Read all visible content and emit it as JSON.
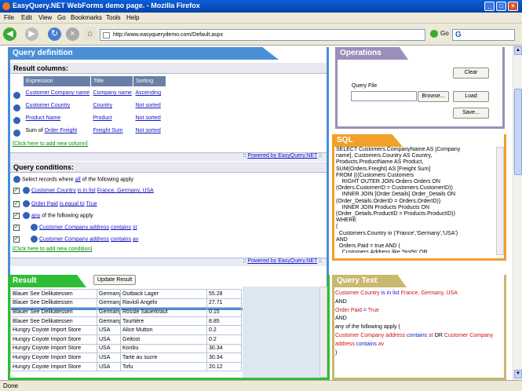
{
  "window": {
    "title": "EasyQuery.NET WebForms demo page. - Mozilla Firefox"
  },
  "menu": [
    "File",
    "Edit",
    "View",
    "Go",
    "Bookmarks",
    "Tools",
    "Help"
  ],
  "nav": {
    "url": "http://www.easyquerydemo.com/Default.aspx",
    "go_label": "Go",
    "search_logo": "G"
  },
  "status": "Done",
  "query_definition": {
    "title": "Query definition",
    "result_columns_label": "Result columns:",
    "headers": [
      "Expression",
      "Title",
      "Sorting"
    ],
    "columns": [
      {
        "pre": "",
        "expr": "Customer Company name",
        "title": "Company name",
        "sort": "Ascending"
      },
      {
        "pre": "",
        "expr": "Customer Country",
        "title": "Country",
        "sort": "Not sorted"
      },
      {
        "pre": "",
        "expr": "Product Name",
        "title": "Product",
        "sort": "Not sorted"
      },
      {
        "pre": "Sum of ",
        "expr": "Order Freight",
        "title": "Freight Sum",
        "sort": "Not sorted"
      }
    ],
    "add_column": "[Click here to add new column]",
    "powered": "Powered by EasyQuery.NET",
    "query_conditions_label": "Query conditions:",
    "cond_root": {
      "pre": "Select records where",
      "mode": "all",
      "post": "of the following apply"
    },
    "conditions": [
      {
        "field": "Customer Country",
        "op": "is in list",
        "value": "France, Germany, USA"
      },
      {
        "field": "Order Paid",
        "op": "is equal to",
        "value": "True"
      },
      {
        "field": "any",
        "op": "",
        "value": "of the following apply"
      },
      {
        "field": "Customer Company address",
        "op": "contains",
        "value": "st"
      },
      {
        "field": "Customer Company address",
        "op": "contains",
        "value": "av"
      }
    ],
    "add_condition": "[Click here to add new condition]"
  },
  "operations": {
    "title": "Operations",
    "clear": "Clear",
    "query_file_label": "Query File",
    "browse": "Browse...",
    "load": "Load",
    "save": "Save..."
  },
  "sql": {
    "title": "SQL",
    "text": "SELECT Customers.CompanyName AS [Company\nname], Customers.Country AS Country,\nProducts.ProductName AS Product,\nSUM(Orders.Freight) AS [Freight Sum]\nFROM (((Customers Customers\n    RIGHT OUTER JOIN Orders Orders ON\n(Orders.CustomerID = Customers.CustomerID))\n    INNER JOIN [Order Details] Order_Details ON\n(Order_Details.OrderID = Orders.OrderID))\n    INNER JOIN Products Products ON\n(Order_Details.ProductID = Products.ProductID))\nWHERE\n(\n  Customers.Country in ('France','Germany','USA')\nAND\n  Orders.Paid = true AND (\n    Customers.Address like '%st%' OR"
  },
  "result": {
    "title": "Result",
    "update": "Update Result",
    "rows": [
      [
        "Blauer See Delikatessen",
        "Germany",
        "Outback Lager",
        "55.28"
      ],
      [
        "Blauer See Delikatessen",
        "Germany",
        "Ravioli Angelo",
        "27.71"
      ],
      [
        "Blauer See Delikatessen",
        "Germany",
        "Rössle Sauerkraut",
        "0.15"
      ],
      [
        "Blauer See Delikatessen",
        "Germany",
        "Tourtière",
        "8.85"
      ],
      [
        "Hungry Coyote Import Store",
        "USA",
        "Alice Mutton",
        "0.2"
      ],
      [
        "Hungry Coyote Import Store",
        "USA",
        "Geitost",
        "0.2"
      ],
      [
        "Hungry Coyote Import Store",
        "USA",
        "Konbu",
        "30.34"
      ],
      [
        "Hungry Coyote Import Store",
        "USA",
        "Tarte au sucre",
        "30.34"
      ],
      [
        "Hungry Coyote Import Store",
        "USA",
        "Tofu",
        "20.12"
      ]
    ]
  },
  "query_text": {
    "title": "Query Text",
    "lines": [
      [
        {
          "t": "Customer Country",
          "c": "red"
        },
        {
          "t": " is in list ",
          "c": "blu"
        },
        {
          "t": "France, Germany, USA",
          "c": "red"
        }
      ],
      [
        {
          "t": "AND",
          "c": ""
        }
      ],
      [
        {
          "t": "Order Paid",
          "c": "red"
        },
        {
          "t": " = ",
          "c": "blu"
        },
        {
          "t": "True",
          "c": "red"
        }
      ],
      [
        {
          "t": "AND",
          "c": ""
        }
      ],
      [
        {
          "t": "any of the following apply (",
          "c": ""
        }
      ],
      [
        {
          "t": "Customer Company address",
          "c": "red"
        },
        {
          "t": " contains ",
          "c": "blu"
        },
        {
          "t": "st",
          "c": "red"
        },
        {
          "t": " OR ",
          "c": ""
        },
        {
          "t": "Customer Company",
          "c": "red"
        }
      ],
      [
        {
          "t": "address",
          "c": "red"
        },
        {
          "t": " contains ",
          "c": "blu"
        },
        {
          "t": "av",
          "c": "red"
        }
      ],
      [
        {
          "t": ")",
          "c": ""
        }
      ]
    ]
  }
}
